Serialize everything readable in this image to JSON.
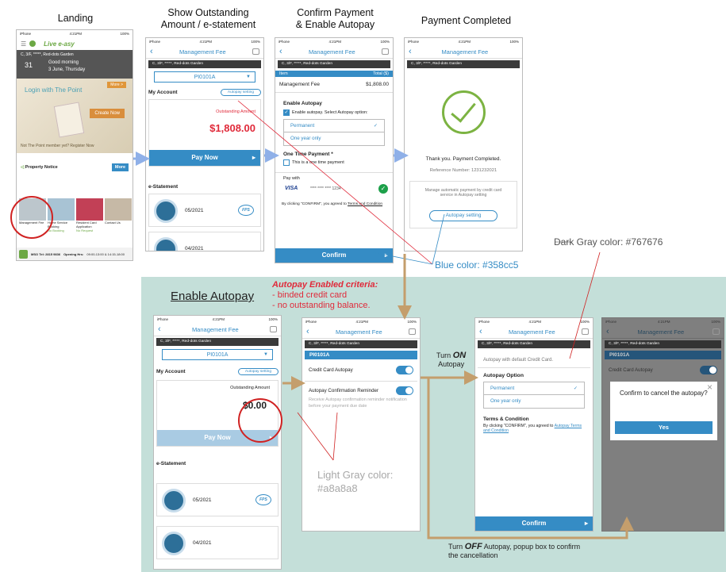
{
  "titles": {
    "landing": "Landing",
    "outstanding_1": "Show Outstanding",
    "outstanding_2": "Amount / e-statement",
    "confirm_1": "Confirm Payment",
    "confirm_2": "& Enable Autopay",
    "completed": "Payment Completed"
  },
  "status": {
    "carrier": "iPhone",
    "time": "4:21PM",
    "battery": "100%"
  },
  "header": {
    "title": "Management Fee"
  },
  "address": "C, 3/F, *****, Red-dots Garden",
  "unit": "PI0101A",
  "landing": {
    "logo": "Live e-asy",
    "greet_1": "Good morning",
    "greet_2": "3 June, Thursday",
    "date_num": "31",
    "login": "Login with The Point",
    "more": "More >",
    "create": "Create Now",
    "promo": "Not The Point member yet? Register Now",
    "notice": "Property Notice",
    "notice_more": "More",
    "tile1": "Management Fee",
    "tile2": "Home Service Booking",
    "tile3": "Resident Card Application",
    "tile4": "Contact Us",
    "sub2": "No Booking",
    "sub3": "No Request",
    "tel": "MSO Tel: 2815 9836",
    "hours_label": "Opening Hrs:",
    "hours": "09:00-13:00 & 14:15-18:00"
  },
  "account": {
    "label": "My Account",
    "autopay_setting": "Autopay setting",
    "outstanding": "Outstanding Amount",
    "amount": "$1,808.00",
    "amount_zero": "$0.00",
    "pay_now": "Pay Now",
    "estatement": "e-Statement",
    "month1": "05/2021",
    "month2": "04/2021",
    "fps": "FPS"
  },
  "confirm": {
    "col_item": "Item",
    "col_total": "Total ($)",
    "fee": "Management Fee",
    "fee_amount": "$1,808.00",
    "enable_autopay": "Enable Autopay",
    "enable_text": "Enable autopay. Select Autopay option:",
    "permanent": "Permanent",
    "one_year": "One year only",
    "one_time": "One Time Payment *",
    "one_time_text": "This is a one time payment",
    "pay_with": "Pay with",
    "visa": "VISA",
    "card": "**** **** **** 1234",
    "agree": "By clicking \"CONFIRM\", you agreed to",
    "terms": "Terms and Condition",
    "confirm_btn": "Confirm"
  },
  "completed": {
    "thanks": "Thank you. Payment Completed.",
    "ref": "Reference Number: 1231232021",
    "manage": "Manage automatic payment by credit card service in Autopay setting",
    "setting_btn": "Autopay setting"
  },
  "annotations": {
    "dark_gray": "Dark Gray color: #767676",
    "blue": "Blue color: #358cc5",
    "light_gray_1": "Light Gray color:",
    "light_gray_2": "#a8a8a8",
    "enable_autopay": "Enable Autopay",
    "criteria_title": "Autopay Enabled criteria:",
    "criteria_1": "- binded credit card",
    "criteria_2": "- no outstanding balance.",
    "turn_on_1": "Turn",
    "turn_on_2": "ON",
    "turn_on_3": "Autopay",
    "turn_off_1": "Turn",
    "turn_off_2": "OFF",
    "turn_off_3": "Autopay, popup box to confirm",
    "turn_off_4": "the cancellation"
  },
  "autopay": {
    "unit_tag": "PI0101A",
    "cc": "Credit Card Autopay",
    "reminder": "Autopay Confirmation Reminder",
    "reminder_text": "Receive Autopay confirmation reminder notification before your payment due date",
    "default_card": "Autopay with default Credit Card.",
    "option": "Autopay Option",
    "terms_title": "Terms & Condition",
    "terms_text": "By clicking \"CONFIRM\", you agreed to",
    "terms_link": "Autopay Terms and Condition",
    "popup_text": "Confirm to cancel the autopay?",
    "yes": "Yes"
  },
  "colors": {
    "blue": "#358cc5",
    "dark_gray": "#767676",
    "light_gray": "#a8a8a8",
    "teal_bg": "#c4dfd9",
    "arrow_blue": "#8fb0e8",
    "arrow_tan": "#c49e6c"
  }
}
